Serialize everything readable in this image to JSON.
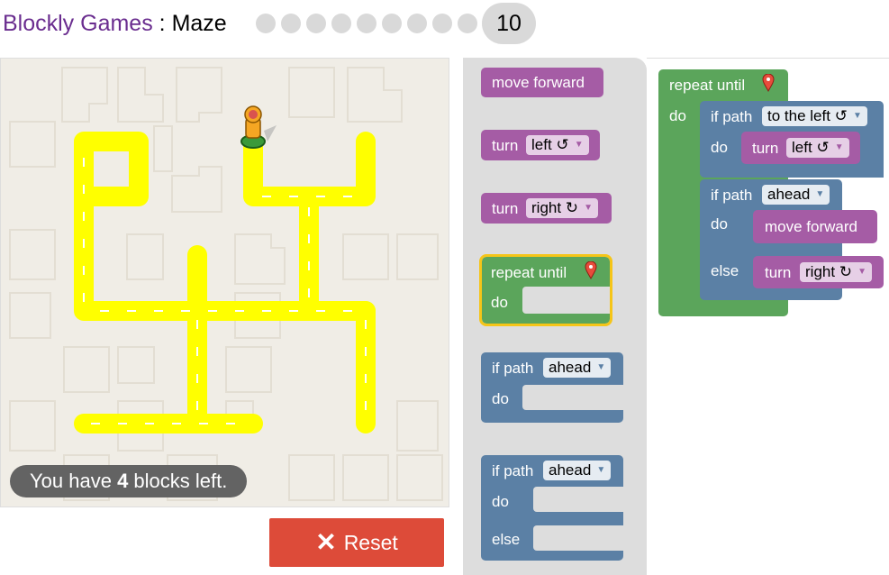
{
  "header": {
    "app_name": "Blockly Games",
    "separator": " : ",
    "game_name": "Maze",
    "level_count_dots": 9,
    "current_level": "10"
  },
  "maze": {
    "capacity_prefix": "You have ",
    "capacity_count": "4",
    "capacity_suffix": " blocks left."
  },
  "controls": {
    "reset_label": "Reset",
    "reset_icon": "close-icon"
  },
  "toolbox": {
    "move_forward": "move forward",
    "turn_left_text": "turn",
    "turn_left_field": "left ↺",
    "turn_right_text": "turn",
    "turn_right_field": "right ↻",
    "repeat_until": "repeat until",
    "repeat_do": "do",
    "if_text": "if path",
    "if_field": "ahead",
    "if_do": "do",
    "ifelse_text": "if path",
    "ifelse_field": "ahead",
    "ifelse_do": "do",
    "ifelse_else": "else"
  },
  "workspace": {
    "repeat_until": "repeat until",
    "repeat_do": "do",
    "if1_text": "if path",
    "if1_field": "to the left ↺",
    "if1_do": "do",
    "if1_turn": "turn",
    "if1_turn_field": "left ↺",
    "if2_text": "if path",
    "if2_field": "ahead",
    "if2_do": "do",
    "if2_move": "move forward",
    "if2_else": "else",
    "if2_turn": "turn",
    "if2_turn_field": "right ↻"
  },
  "colors": {
    "path": "#ffff00",
    "movement_block": "#a55ca5",
    "loop_block": "#5ba55b",
    "logic_block": "#5b80a5",
    "reset_button": "#dd4b39"
  }
}
